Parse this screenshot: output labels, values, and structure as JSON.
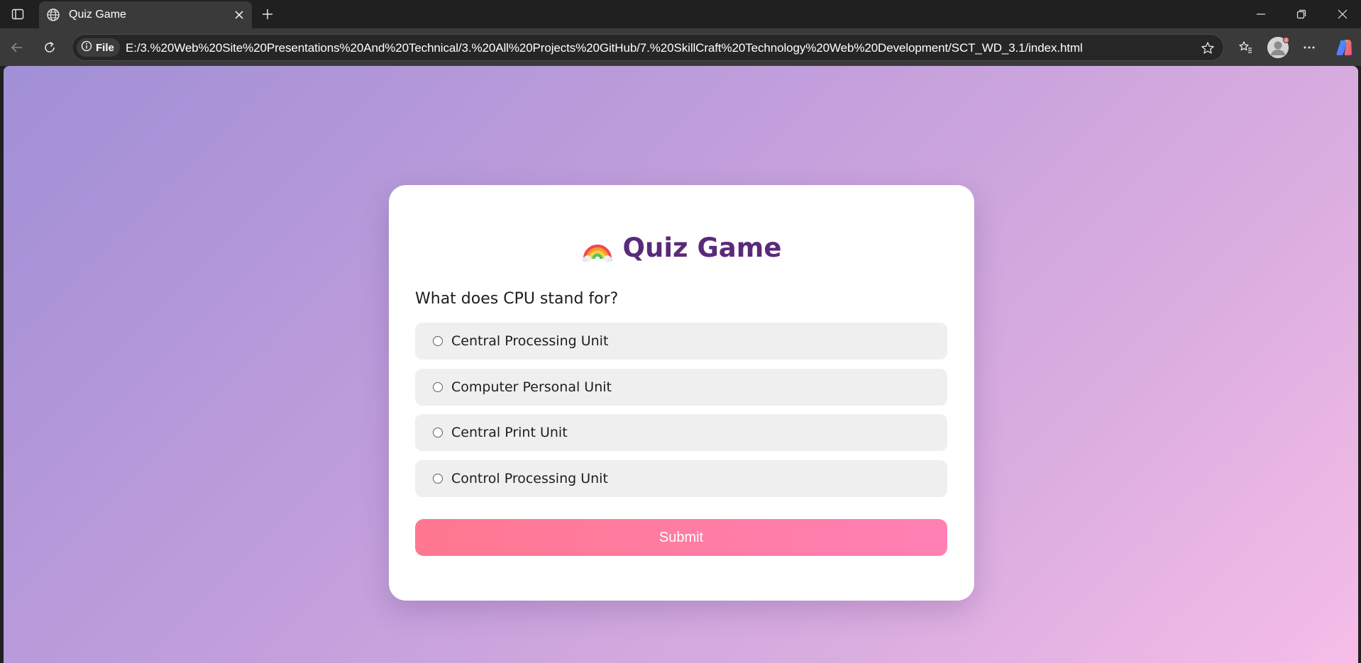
{
  "browser": {
    "tab": {
      "title": "Quiz Game"
    },
    "address_bar": {
      "chip_label": "File",
      "url": "E:/3.%20Web%20Site%20Presentations%20And%20Technical/3.%20All%20Projects%20GitHub/7.%20SkillCraft%20Technology%20Web%20Development/SCT_WD_3.1/index.html"
    }
  },
  "quiz": {
    "title": "Quiz Game",
    "title_emoji": "rainbow-icon",
    "question": "What does CPU stand for?",
    "options": [
      "Central Processing Unit",
      "Computer Personal Unit",
      "Central Print Unit",
      "Control Processing Unit"
    ],
    "submit_label": "Submit"
  },
  "colors": {
    "title": "#5a2a78",
    "submit_start": "#ff7890",
    "submit_end": "#ff80b4",
    "background_start": "#a18fd6",
    "background_end": "#f6bde8"
  }
}
